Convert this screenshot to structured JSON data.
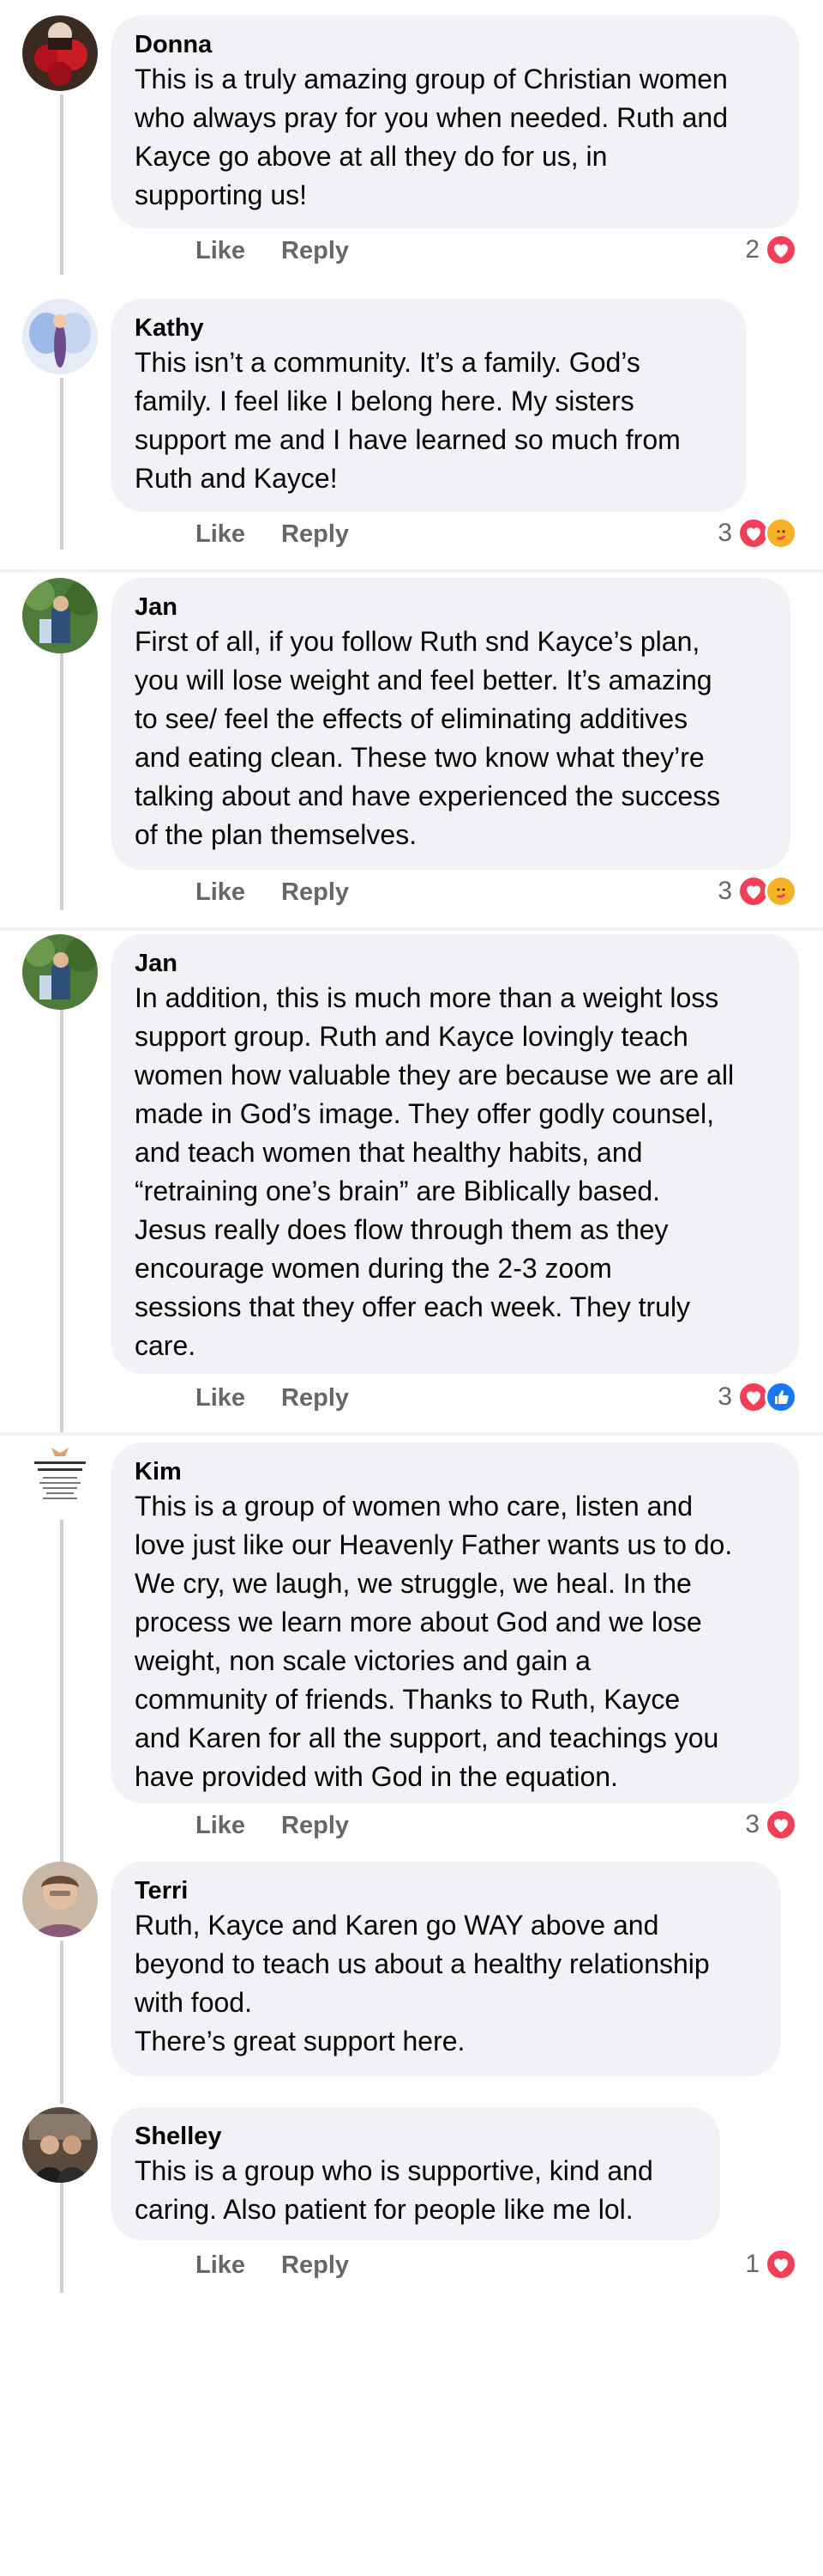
{
  "colors": {
    "bubble": "#f0f2f5",
    "heart": "#f33e58",
    "like": "#1877f2",
    "care": "#f7b125",
    "meta": "#65676b"
  },
  "comments": [
    {
      "author": "Donna",
      "text": "This is a truly amazing group of Christian women\nwho always pray for you when needed. Ruth and\nKayce go above at all they do for us, in\nsupporting us!",
      "like_label": "Like",
      "reply_label": "Reply",
      "reaction_count": "2",
      "reactions": [
        "heart"
      ],
      "avatar_icon": "roses-avatar"
    },
    {
      "author": "Kathy",
      "text": "This isn’t a community.  It’s a family.  God’s\nfamily.  I feel like I belong here.  My sisters\nsupport me and I have learned so much from\nRuth and Kayce!",
      "like_label": "Like",
      "reply_label": "Reply",
      "reaction_count": "3",
      "reactions": [
        "heart",
        "care"
      ],
      "avatar_icon": "butterfly-avatar"
    },
    {
      "author": "Jan",
      "text": "First of all, if you follow Ruth snd Kayce’s plan,\nyou will lose weight and feel better. It’s amazing\nto see/ feel the effects of eliminating additives\nand eating clean. These two know what they’re\ntalking about and have experienced the success\nof the plan themselves.",
      "like_label": "Like",
      "reply_label": "Reply",
      "reaction_count": "3",
      "reactions": [
        "heart",
        "care"
      ],
      "avatar_icon": "garden-avatar"
    },
    {
      "author": "Jan",
      "text": "In addition, this is much more than a weight loss\nsupport group.  Ruth and Kayce lovingly teach\nwomen how valuable they are because we are all\nmade in God’s image.  They offer godly counsel,\nand teach women that healthy habits, and\n“retraining one’s brain” are Biblically based.\nJesus really does flow through them as they\nencourage women during  the 2-3 zoom\nsessions that they offer each week.   They truly\ncare.",
      "like_label": "Like",
      "reply_label": "Reply",
      "reaction_count": "3",
      "reactions": [
        "heart",
        "like"
      ],
      "avatar_icon": "garden-avatar"
    },
    {
      "author": "Kim",
      "text": "This is a group of women who care, listen and\nlove just like our Heavenly Father wants us to do.\nWe cry, we laugh, we struggle, we heal. In the\nprocess we learn more about God and we lose\nweight, non scale victories and gain a\ncommunity of friends. Thanks to Ruth, Kayce\nand Karen for all the support, and teachings you\nhave provided with God in the equation.",
      "like_label": "Like",
      "reply_label": "Reply",
      "reaction_count": "3",
      "reactions": [
        "heart"
      ],
      "avatar_icon": "quote-card-avatar",
      "avatar_text": "Never regret a day in your life."
    },
    {
      "author": "Terri",
      "text": "Ruth, Kayce and Karen go WAY above and\nbeyond to teach us about a healthy relationship\nwith food.\nThere’s great support here.",
      "like_label": "",
      "reply_label": "",
      "reaction_count": "",
      "reactions": [],
      "avatar_icon": "portrait-avatar"
    },
    {
      "author": "Shelley",
      "text": "This is a group who is supportive, kind and\ncaring. Also patient for people like me lol.",
      "like_label": "Like",
      "reply_label": "Reply",
      "reaction_count": "1",
      "reactions": [
        "heart"
      ],
      "avatar_icon": "couple-avatar"
    }
  ]
}
